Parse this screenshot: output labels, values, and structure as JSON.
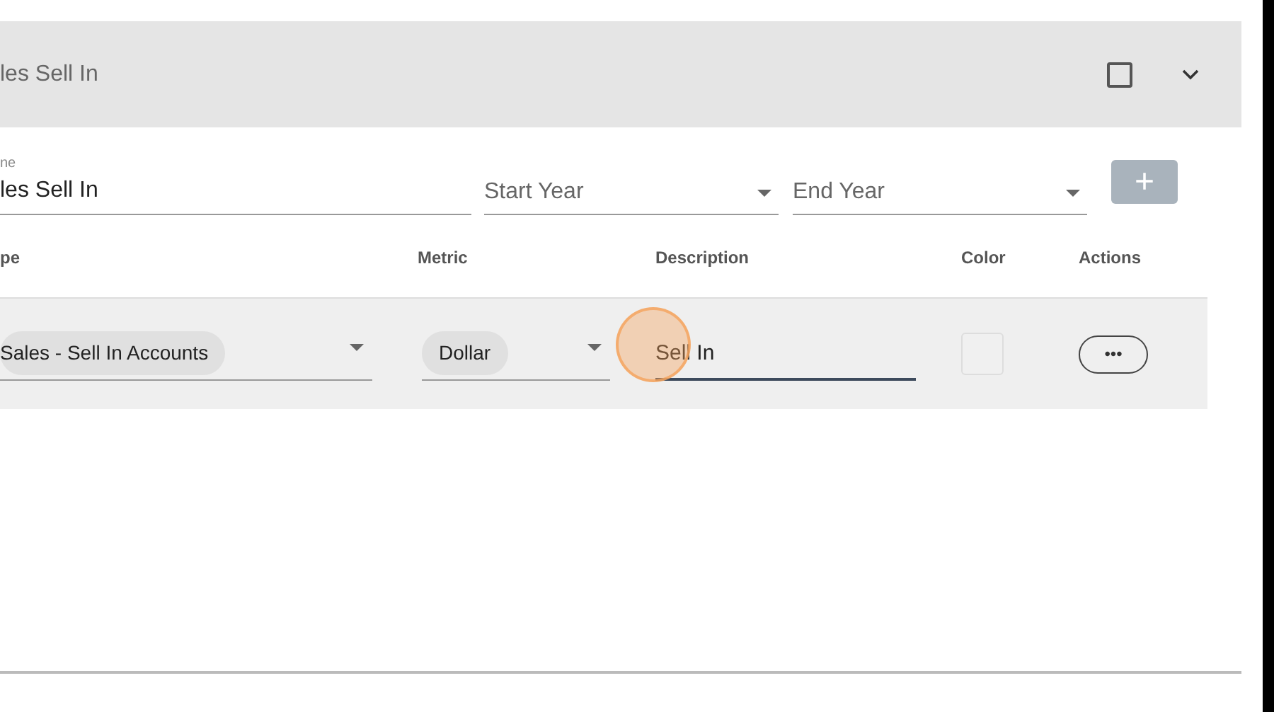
{
  "header": {
    "title": "les Sell In",
    "checked": false,
    "expanded": false
  },
  "form": {
    "name_label": "ne",
    "name_value": "les Sell In",
    "start_year": {
      "placeholder": "Start Year"
    },
    "end_year": {
      "placeholder": "End Year"
    },
    "add_button": "+"
  },
  "table": {
    "columns": [
      "pe",
      "Metric",
      "Description",
      "Color",
      "Actions"
    ],
    "rows": [
      {
        "type": "Sales - Sell In Accounts",
        "metric": "Dollar",
        "description": "Sell In",
        "actions": "•••"
      }
    ]
  }
}
